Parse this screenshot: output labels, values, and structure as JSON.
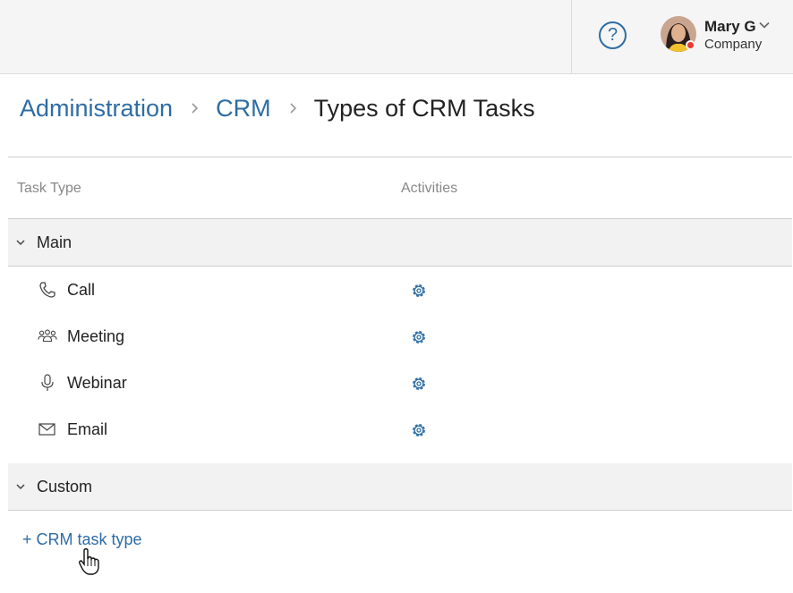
{
  "header": {
    "help_icon": "question-circle-icon",
    "help_glyph": "?",
    "user": {
      "name": "Mary G",
      "company": "Company",
      "status_color": "#e53935"
    }
  },
  "breadcrumb": {
    "items": [
      "Administration",
      "CRM"
    ],
    "current": "Types of CRM Tasks"
  },
  "table": {
    "columns": {
      "task_type": "Task Type",
      "activities": "Activities"
    },
    "groups": [
      {
        "label": "Main",
        "rows": [
          {
            "label": "Call",
            "icon": "phone-icon"
          },
          {
            "label": "Meeting",
            "icon": "people-icon"
          },
          {
            "label": "Webinar",
            "icon": "microphone-icon"
          },
          {
            "label": "Email",
            "icon": "envelope-icon"
          }
        ]
      },
      {
        "label": "Custom",
        "rows": []
      }
    ]
  },
  "actions": {
    "add_task_type": "+ CRM task type"
  },
  "colors": {
    "accent": "#2e6da4",
    "text": "#222222",
    "muted": "#888888",
    "alert": "#e53935"
  }
}
